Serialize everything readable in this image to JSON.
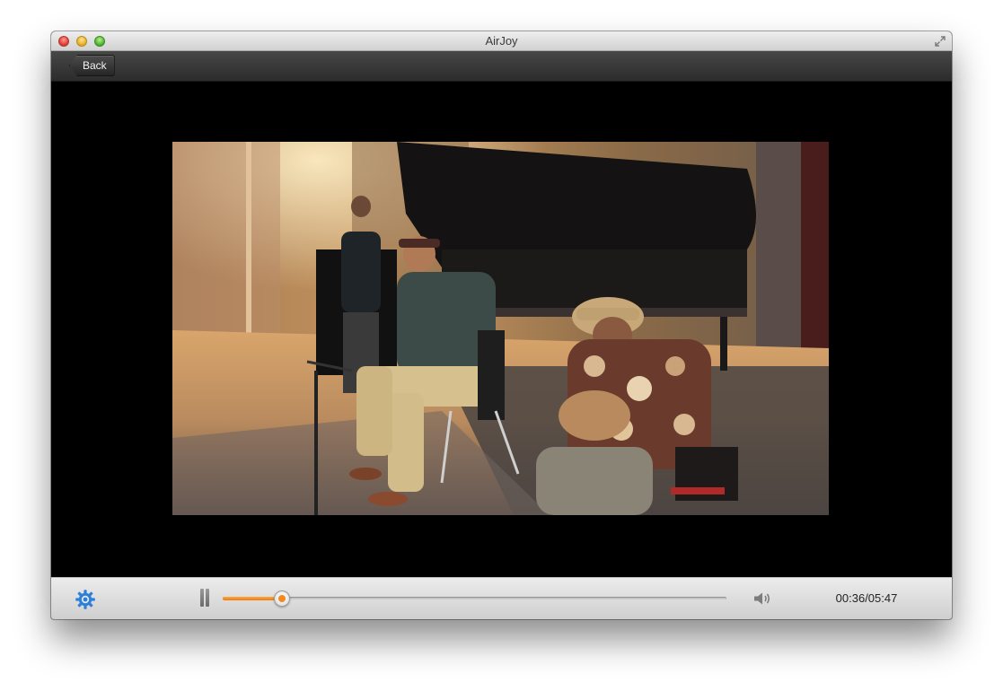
{
  "window": {
    "title": "AirJoy"
  },
  "toolbar": {
    "back_label": "Back"
  },
  "player": {
    "current_time": "00:36",
    "duration": "05:47",
    "time_label": "00:36/05:47",
    "progress_fraction": 0.117,
    "state": "playing",
    "accent_color": "#f28a1f"
  },
  "icons": {
    "settings": "gear-icon",
    "pause": "pause-icon",
    "volume": "speaker-icon",
    "fullscreen": "fullscreen-icon"
  }
}
